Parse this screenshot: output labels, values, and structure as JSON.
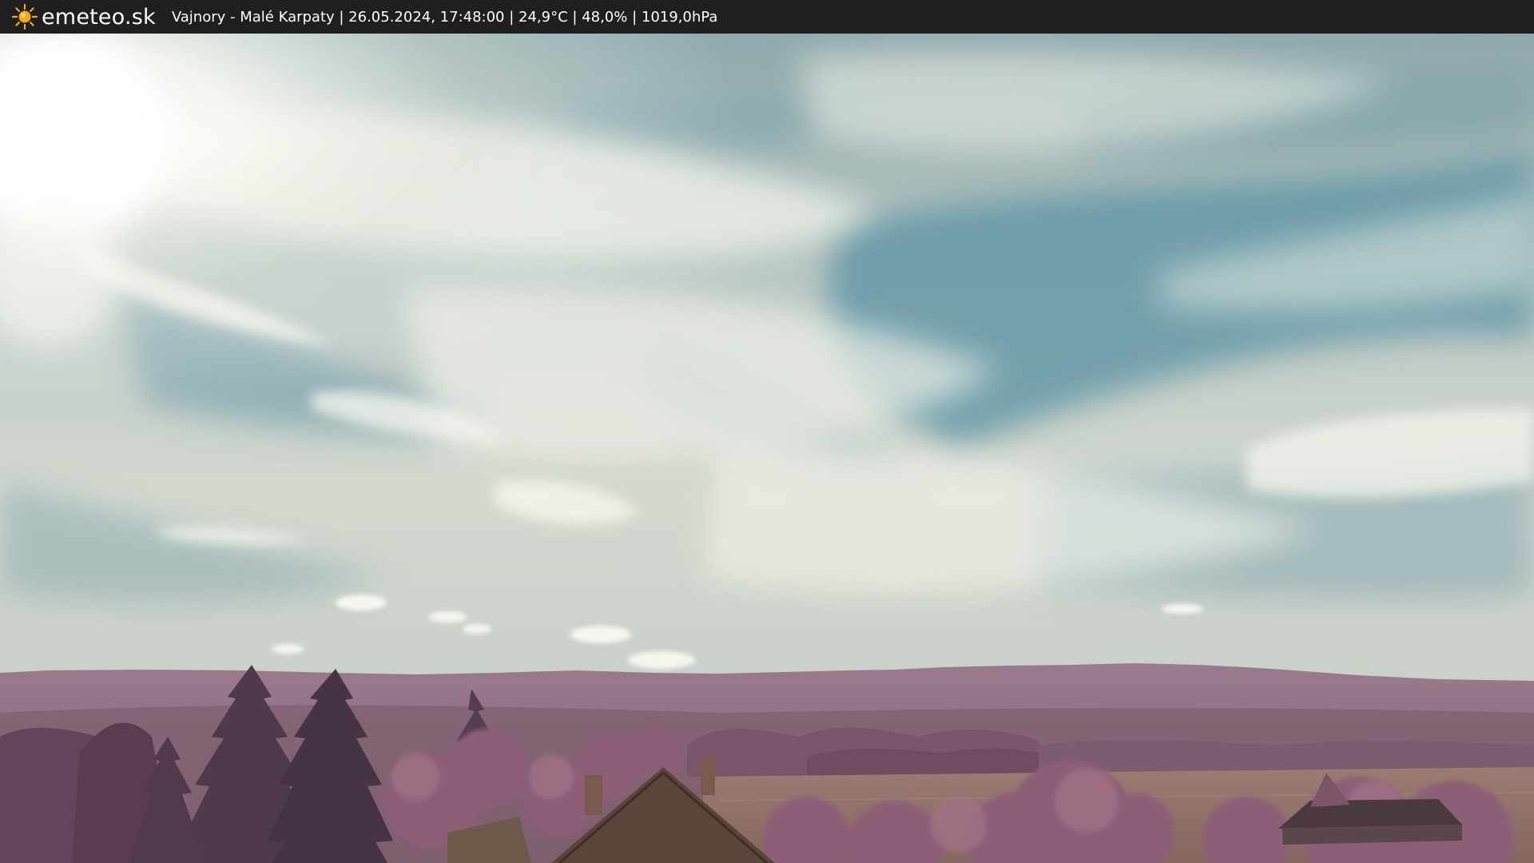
{
  "header": {
    "brand": "emeteo.sk",
    "logo_icon": "sun-icon",
    "caption": "Vajnory - Malé Karpaty | 26.05.2024, 17:48:00 | 24,9°C | 48,0% | 1019,0hPa"
  },
  "colors": {
    "bar_background": "#1f1f1f",
    "bar_text": "#ffffff",
    "logo_sun": "#f6a81c",
    "sky_blue": "#5f97a6",
    "cloud_white": "#e6e9e1",
    "foliage_infrared": "#8a5d74",
    "field": "#8f7067"
  }
}
